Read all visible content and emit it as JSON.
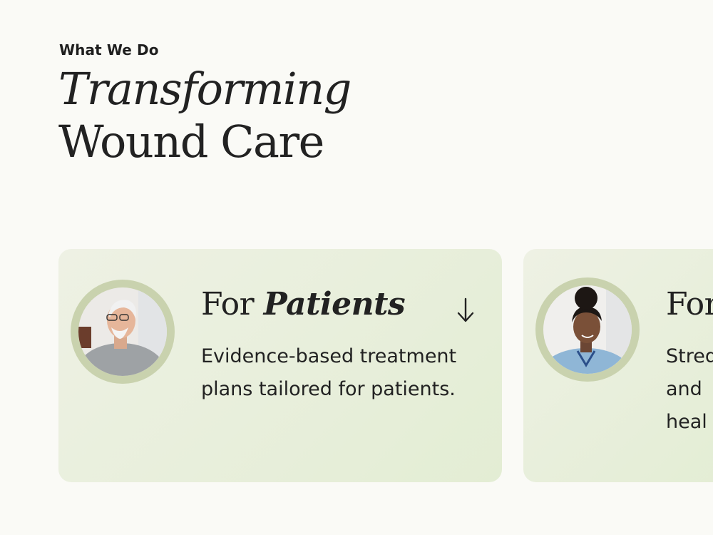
{
  "section": {
    "eyebrow": "What We Do",
    "heading_line1": "Transforming",
    "heading_line2": "Wound Care"
  },
  "cards": [
    {
      "title_prefix": "For",
      "title_emphasis": "Patients",
      "description": "Evidence-based treatment plans tailored for patients.",
      "avatar": "elderly-man-photo",
      "action_icon": "arrow-down-icon"
    },
    {
      "title_prefix": "For",
      "description_lines": [
        "Stred",
        "and",
        "heal"
      ],
      "avatar": "nurse-photo"
    }
  ],
  "colors": {
    "background": "#fafaf6",
    "card": "#e6eed8",
    "avatar_ring": "#c9d2ae",
    "text": "#222222"
  }
}
